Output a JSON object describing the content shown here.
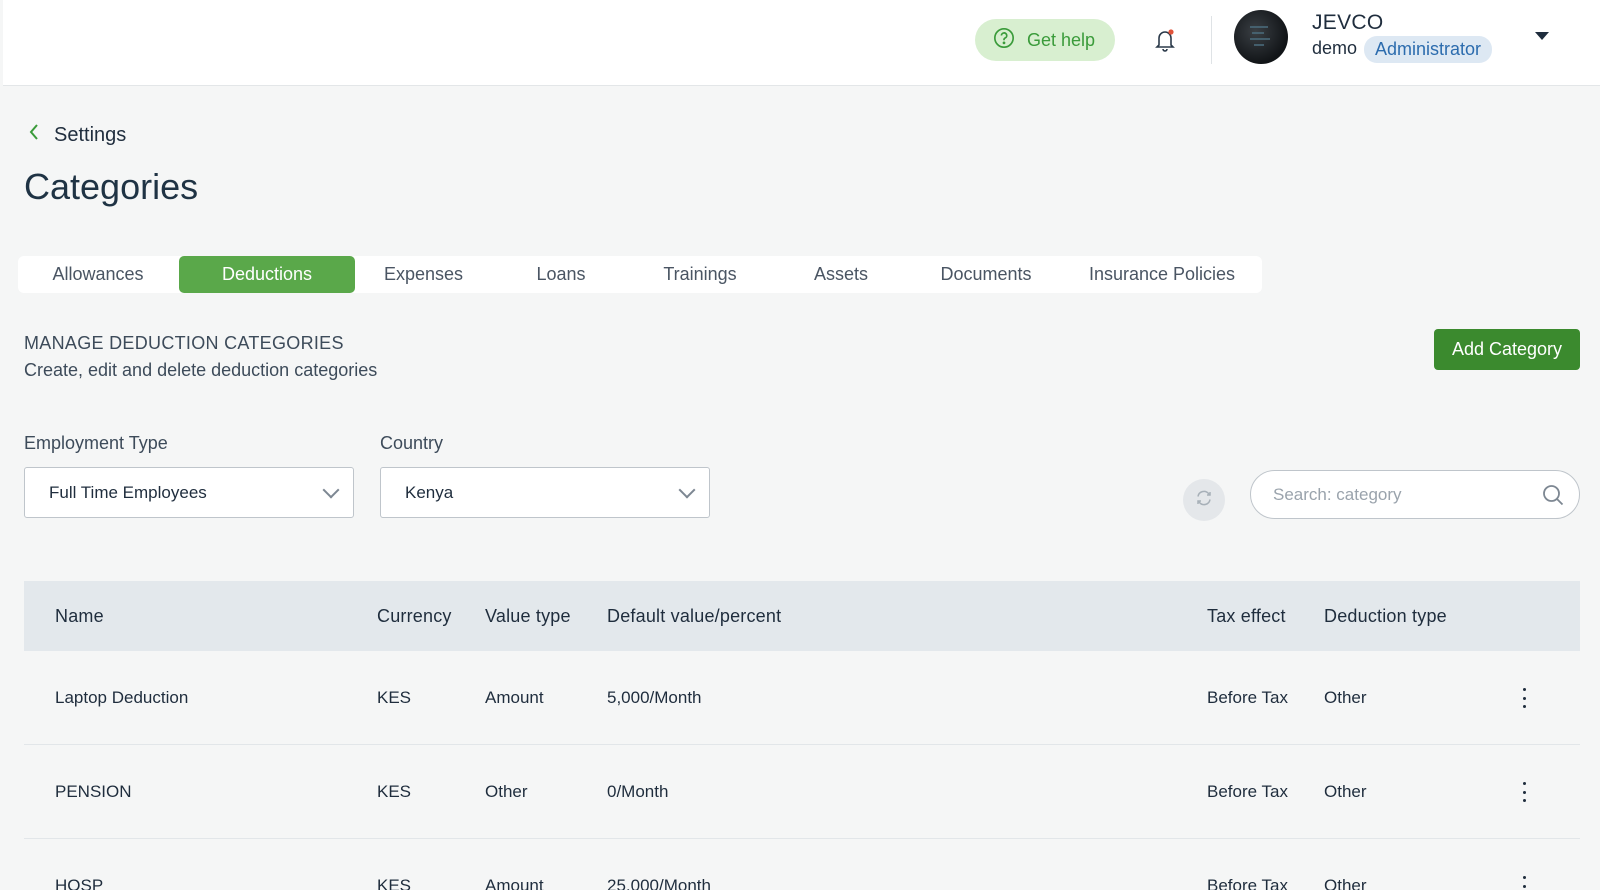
{
  "topbar": {
    "help_label": "Get help",
    "user": {
      "org": "JEVCO",
      "name": "demo",
      "role": "Administrator"
    }
  },
  "header": {
    "back_label": "Settings",
    "title": "Categories"
  },
  "tabs": [
    {
      "label": "Allowances",
      "active": false
    },
    {
      "label": "Deductions",
      "active": true
    },
    {
      "label": "Expenses",
      "active": false
    },
    {
      "label": "Loans",
      "active": false
    },
    {
      "label": "Trainings",
      "active": false
    },
    {
      "label": "Assets",
      "active": false
    },
    {
      "label": "Documents",
      "active": false
    },
    {
      "label": "Insurance Policies",
      "active": false
    }
  ],
  "section": {
    "title": "MANAGE DEDUCTION CATEGORIES",
    "subtitle": "Create, edit and delete deduction categories",
    "add_label": "Add Category"
  },
  "filters": {
    "employment_type": {
      "label": "Employment Type",
      "value": "Full Time Employees"
    },
    "country": {
      "label": "Country",
      "value": "Kenya"
    },
    "search_placeholder": "Search: category"
  },
  "table": {
    "columns": [
      "Name",
      "Currency",
      "Value type",
      "Default value/percent",
      "Tax effect",
      "Deduction type"
    ],
    "rows": [
      [
        "Laptop Deduction",
        "KES",
        "Amount",
        "5,000/Month",
        "Before Tax",
        "Other"
      ],
      [
        "PENSION",
        "KES",
        "Other",
        "0/Month",
        "Before Tax",
        "Other"
      ],
      [
        "HOSP",
        "KES",
        "Amount",
        "25,000/Month",
        "Before Tax",
        "Other"
      ]
    ]
  },
  "colors": {
    "accent_green": "#5aa84a",
    "button_green": "#3b8a2e",
    "help_bg": "#d8efd0",
    "role_badge_bg": "#dde8f3",
    "role_badge_text": "#2c6cae"
  }
}
